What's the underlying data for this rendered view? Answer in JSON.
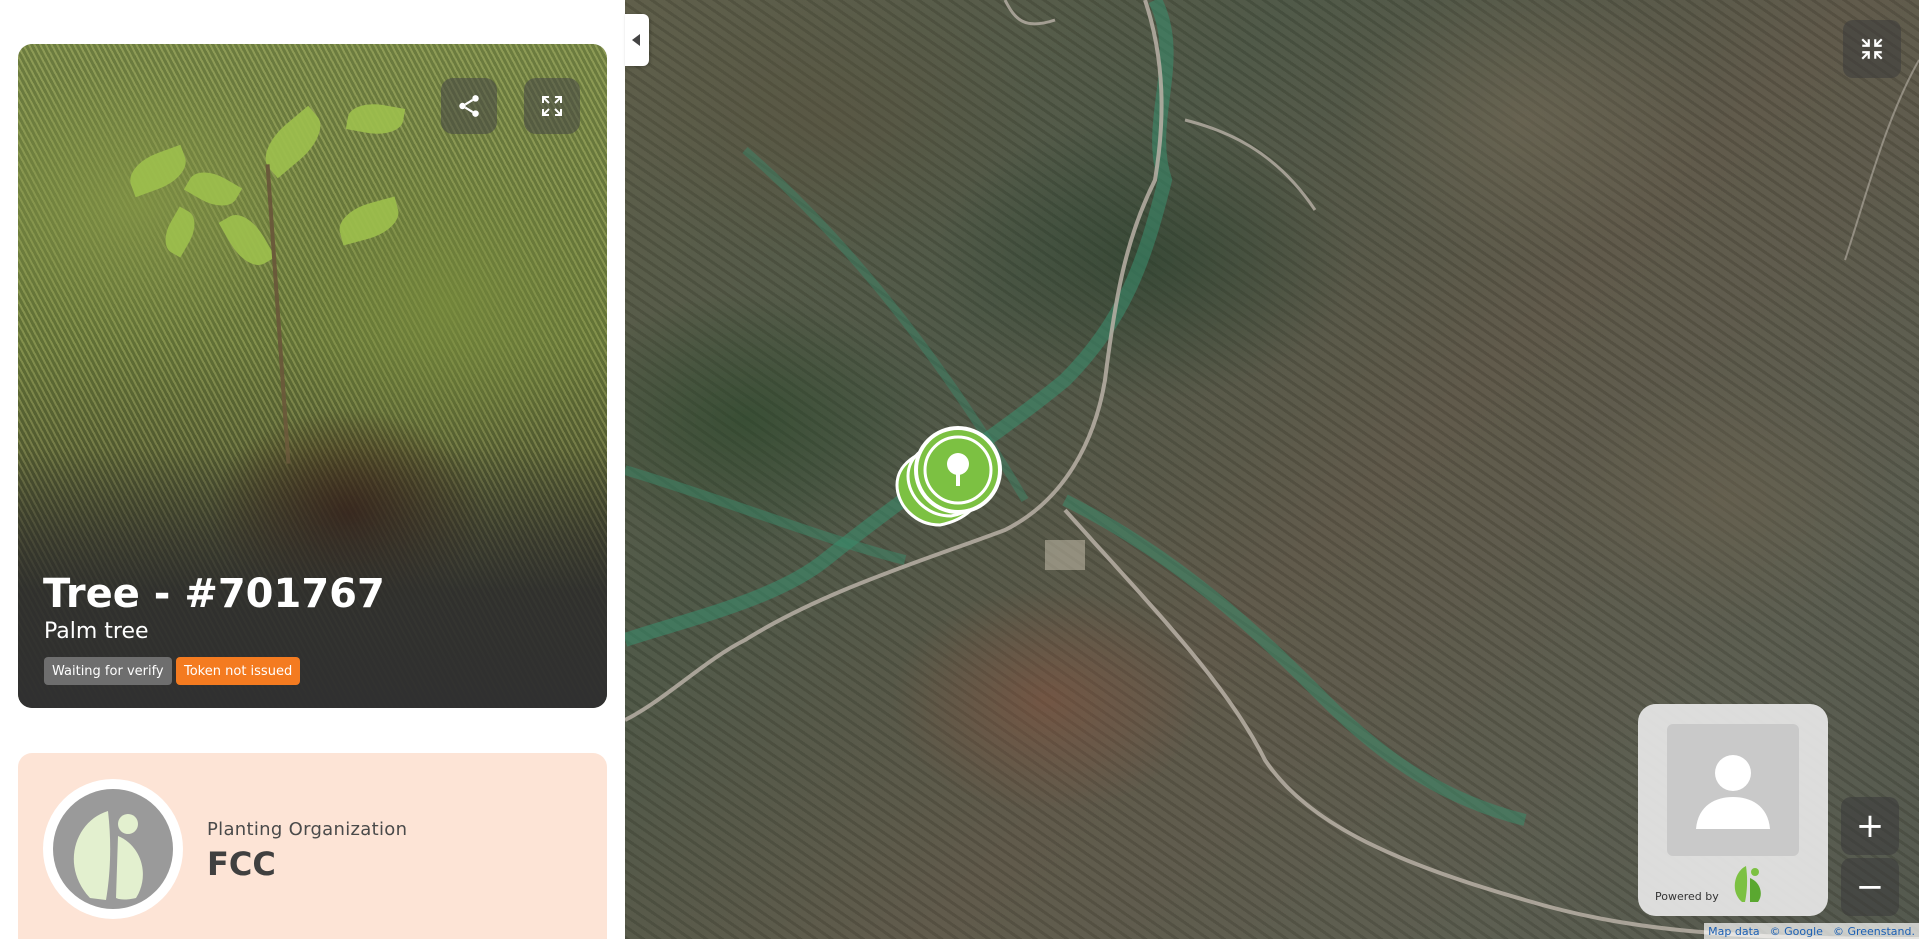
{
  "tree": {
    "title": "Tree - #701767",
    "species": "Palm tree",
    "badges": {
      "verify": "Waiting for verify",
      "token": "Token not issued"
    }
  },
  "organization": {
    "label": "Planting Organization",
    "name": "FCC"
  },
  "map": {
    "zoom_in": "+",
    "zoom_out": "−",
    "powered_by": "Powered by",
    "attribution": {
      "map_data": "Map data",
      "google": "© Google",
      "greenstand": "© Greenstand."
    }
  },
  "colors": {
    "badge_verify": "#6e6e6e",
    "badge_token": "#f47b20",
    "org_card_bg": "#fde4d6",
    "marker_green": "#7cc142"
  }
}
